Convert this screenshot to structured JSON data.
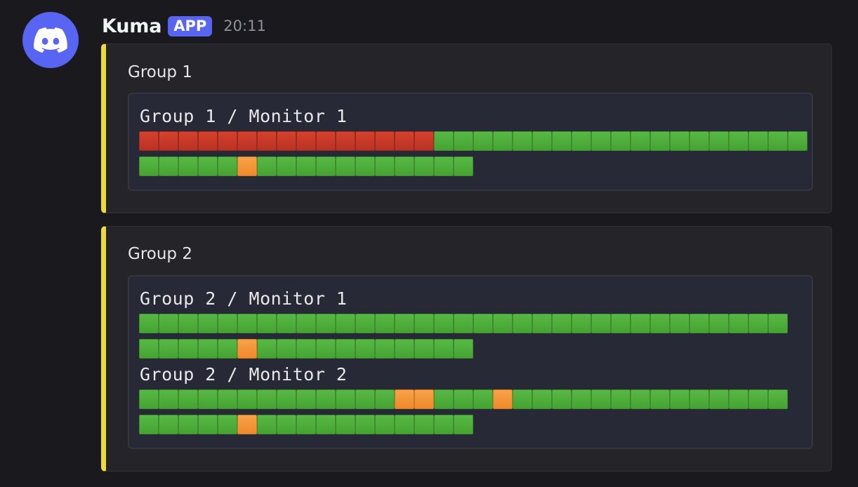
{
  "message": {
    "author": "Kuma",
    "badge": "APP",
    "time": "20:11",
    "avatar_icon": "discord-icon",
    "avatar_color": "#5865f2"
  },
  "colors": {
    "embed_accent": "#f0d93a",
    "up": "#4fb03c",
    "down": "#c73a29",
    "pending": "#f39638"
  },
  "embeds": [
    {
      "title": "Group 1",
      "monitors": [
        {
          "name": "Group 1 / Monitor 1",
          "rows": [
            "RRRRRRRRRRRRRRRGGGGGGGGGGGGGGGGGGG",
            "GGGGGOGGGGGGGGGGG"
          ]
        }
      ]
    },
    {
      "title": "Group 2",
      "monitors": [
        {
          "name": "Group 2 / Monitor 1",
          "rows": [
            "GGGGGGGGGGGGGGGGGGGGGGGGGGGGGGGGG",
            "GGGGGOGGGGGGGGGGG"
          ]
        },
        {
          "name": "Group 2 / Monitor 2",
          "rows": [
            "GGGGGGGGGGGGGOOGGGOGGGGGGGGGGGGGG",
            "GGGGGOGGGGGGGGGGG"
          ]
        }
      ]
    }
  ]
}
